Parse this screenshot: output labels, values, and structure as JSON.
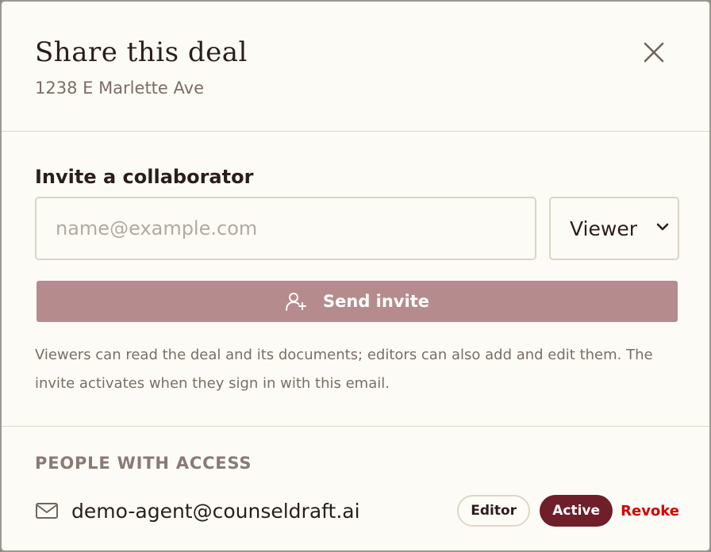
{
  "header": {
    "title": "Share this deal",
    "subtitle": "1238 E Marlette Ave"
  },
  "invite": {
    "heading": "Invite a collaborator",
    "email_placeholder": "name@example.com",
    "email_value": "",
    "role_selected": "Viewer",
    "send_label": "Send invite",
    "help_text": "Viewers can read the deal and its documents; editors can also add and edit them. The invite activates when they sign in with this email."
  },
  "access": {
    "heading": "PEOPLE WITH ACCESS",
    "members": [
      {
        "email": "demo-agent@counseldraft.ai",
        "role": "Editor",
        "status": "Active",
        "revoke_label": "Revoke"
      }
    ]
  },
  "colors": {
    "background": "#fdfbf5",
    "send_button": "#b68b8d",
    "status_active": "#6e1f2a",
    "revoke": "#d40000",
    "text_primary": "#2b1d1d",
    "text_muted": "#7a6e65"
  },
  "icons": {
    "close": "close-icon",
    "chevron": "chevron-down-icon",
    "send": "user-plus-icon",
    "member": "mail-icon"
  }
}
